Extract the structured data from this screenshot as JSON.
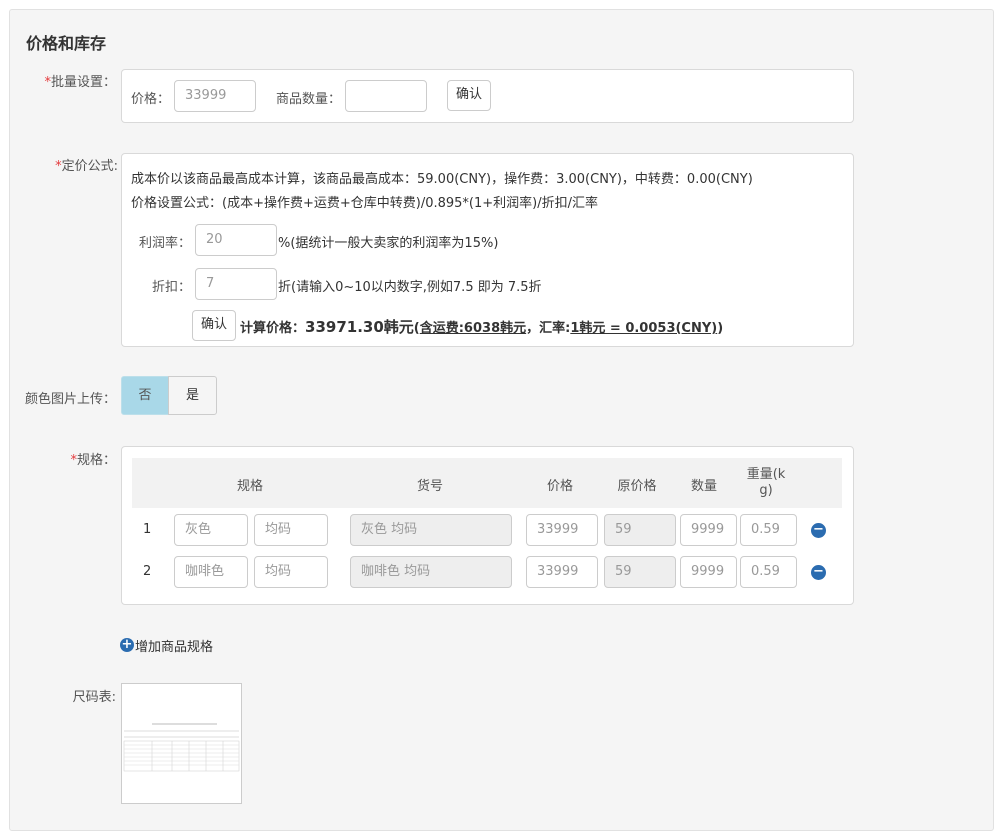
{
  "section": {
    "title": "价格和库存"
  },
  "batch": {
    "label": "批量设置：",
    "price_label": "价格：",
    "price_value": "33999",
    "qty_label": "商品数量：",
    "qty_value": "",
    "confirm": "确认"
  },
  "formula": {
    "label": "定价公式:",
    "line1": "成本价以该商品最高成本计算，该商品最高成本：59.00(CNY)，操作费：3.00(CNY)，中转费：0.00(CNY)",
    "line2": "价格设置公式：(成本+操作费+运费+仓库中转费)/0.895*(1+利润率)/折扣/汇率",
    "profit_label": "利润率：",
    "profit_value": "20",
    "profit_hint": "%(据统计一般大卖家的利润率为15%)",
    "discount_label": "折扣：",
    "discount_value": "7",
    "discount_hint": "折(请输入0~10以内数字,例如7.5 即为 7.5折",
    "confirm": "确认",
    "calc_prefix": "计算价格：",
    "calc_price": "33971.30韩元",
    "calc_open": "(",
    "calc_shipping": "含运费:6038韩元",
    "calc_mid": "，汇率:",
    "calc_rate": "1韩元 = 0.0053(CNY)",
    "calc_close": ")"
  },
  "color_upload": {
    "label": "颜色图片上传：",
    "no": "否",
    "yes": "是",
    "selected": "否"
  },
  "spec": {
    "label": "规格：",
    "headers": [
      "规格",
      "货号",
      "价格",
      "原价格",
      "数量",
      "重量(k",
      "g)"
    ],
    "rows": [
      {
        "index": "1",
        "color": "灰色",
        "size": "均码",
        "sku": "灰色 均码",
        "price": "33999",
        "orig_price": "59",
        "qty": "9999",
        "weight": "0.59"
      },
      {
        "index": "2",
        "color": "咖啡色",
        "size": "均码",
        "sku": "咖啡色 均码",
        "price": "33999",
        "orig_price": "59",
        "qty": "9999",
        "weight": "0.59"
      }
    ],
    "minus_icon": "−",
    "add_label": "增加商品规格",
    "add_icon": "+"
  },
  "size_chart": {
    "label": "尺码表:"
  },
  "colors": {
    "accent": "#2b6cb0",
    "toggle_selected": "#a9d8e8",
    "required": "#e4393c"
  }
}
